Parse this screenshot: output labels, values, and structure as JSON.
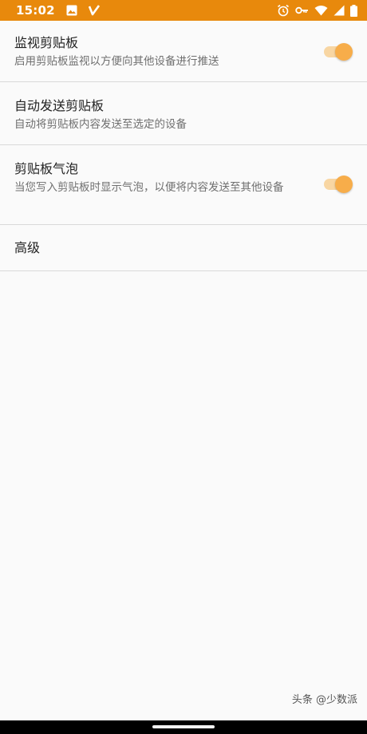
{
  "status_bar": {
    "time": "15:02",
    "left_icons": [
      "image-icon",
      "v-check-icon"
    ],
    "right_icons": [
      "alarm-icon",
      "key-icon",
      "wifi-icon",
      "signal-icon",
      "battery-icon"
    ],
    "color": "#e8890c"
  },
  "preferences": [
    {
      "title": "监视剪贴板",
      "summary": "启用剪贴板监视以方便向其他设备进行推送",
      "switch_on": true
    },
    {
      "title": "自动发送剪贴板",
      "summary": "自动将剪贴板内容发送至选定的设备"
    },
    {
      "title": "剪贴板气泡",
      "summary": "当您写入剪贴板时显示气泡，以便将内容发送至其他设备",
      "switch_on": true
    },
    {
      "title": "高级"
    }
  ],
  "accent_color": "#f7ad4a",
  "watermark": "头条 @少数派"
}
